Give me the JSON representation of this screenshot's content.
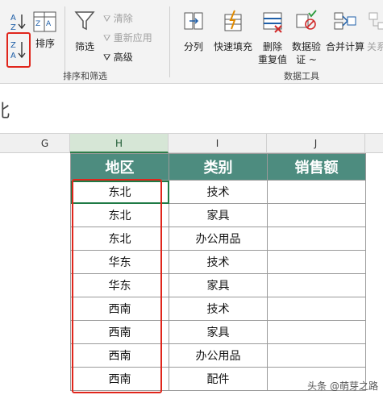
{
  "ribbon": {
    "sort_asc_icon_text": "A↓Z",
    "sort_desc_icon_text": "Z↓A",
    "sort_label": "排序",
    "filter_label": "筛选",
    "clear_label": "清除",
    "reapply_label": "重新应用",
    "advanced_label": "高级",
    "group_sort_filter": "排序和筛选",
    "split_label": "分列",
    "flash_fill_label": "快速填充",
    "remove_dup_label_1": "删除",
    "remove_dup_label_2": "重复值",
    "validation_label_1": "数据验",
    "validation_label_2": "证 ~",
    "consolidate_label": "合并计算",
    "relations_label": "关系",
    "group_data_tools": "数据工具"
  },
  "formula_bar": {
    "text": "北"
  },
  "columns": {
    "G": "G",
    "H": "H",
    "I": "I",
    "J": "J"
  },
  "table": {
    "headers": [
      "地区",
      "类别",
      "销售额"
    ],
    "rows": [
      [
        "东北",
        "技术",
        ""
      ],
      [
        "东北",
        "家具",
        ""
      ],
      [
        "东北",
        "办公用品",
        ""
      ],
      [
        "华东",
        "技术",
        ""
      ],
      [
        "华东",
        "家具",
        ""
      ],
      [
        "西南",
        "技术",
        ""
      ],
      [
        "西南",
        "家具",
        ""
      ],
      [
        "西南",
        "办公用品",
        ""
      ],
      [
        "西南",
        "配件",
        ""
      ]
    ]
  },
  "watermark": "头条 @萌芽之路",
  "colors": {
    "header_bg": "#4d8c7f",
    "highlight": "#e0261c",
    "selected_col": "#d6e6d6"
  }
}
